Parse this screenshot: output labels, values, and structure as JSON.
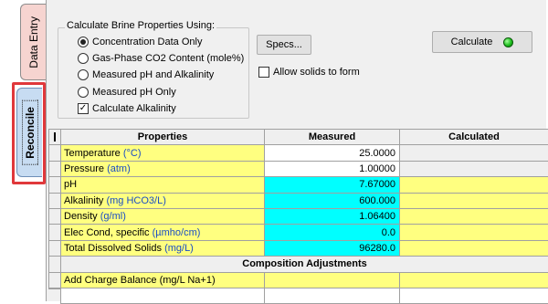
{
  "tabs": {
    "data_entry": "Data Entry",
    "reconcile": "Reconcile"
  },
  "options": {
    "group_title": "Calculate Brine Properties Using:",
    "radios": [
      {
        "label": "Concentration Data Only",
        "selected": true
      },
      {
        "label": "Gas-Phase CO2 Content (mole%)",
        "selected": false
      },
      {
        "label": "Measured pH and Alkalinity",
        "selected": false
      },
      {
        "label": "Measured pH Only",
        "selected": false
      }
    ],
    "calc_alkalinity": {
      "label": "Calculate Alkalinity",
      "checked": true
    }
  },
  "buttons": {
    "specs": "Specs...",
    "calculate": "Calculate",
    "calculate_status": "green"
  },
  "allow_solids": {
    "label": "Allow solids to form",
    "checked": false
  },
  "grid": {
    "headers": [
      "Properties",
      "Measured",
      "Calculated"
    ],
    "rows": [
      {
        "name": "Temperature",
        "unit": "(°C)",
        "measured": "25.0000",
        "calculated": ""
      },
      {
        "name": "Pressure",
        "unit": "(atm)",
        "measured": "1.00000",
        "calculated": ""
      },
      {
        "name": "pH",
        "unit": "",
        "measured": "7.67000",
        "calculated": ""
      },
      {
        "name": "Alkalinity",
        "unit": "(mg HCO3/L)",
        "measured": "600.000",
        "calculated": ""
      },
      {
        "name": "Density",
        "unit": "(g/ml)",
        "measured": "1.06400",
        "calculated": ""
      },
      {
        "name": "Elec Cond, specific",
        "unit": "(µmho/cm)",
        "measured": "0.0",
        "calculated": ""
      },
      {
        "name": "Total Dissolved Solids",
        "unit": "(mg/L)",
        "measured": "96280.0",
        "calculated": ""
      }
    ],
    "section_title": "Composition Adjustments",
    "adjust_rows": [
      {
        "name": "Add Charge Balance (mg/L Na+1)",
        "measured": "",
        "calculated": ""
      }
    ]
  },
  "colors": {
    "input_yellow": "#ffff80",
    "input_cyan": "#00ffff",
    "unit_blue": "#1a4dc4",
    "highlight_red": "#e0383b"
  }
}
